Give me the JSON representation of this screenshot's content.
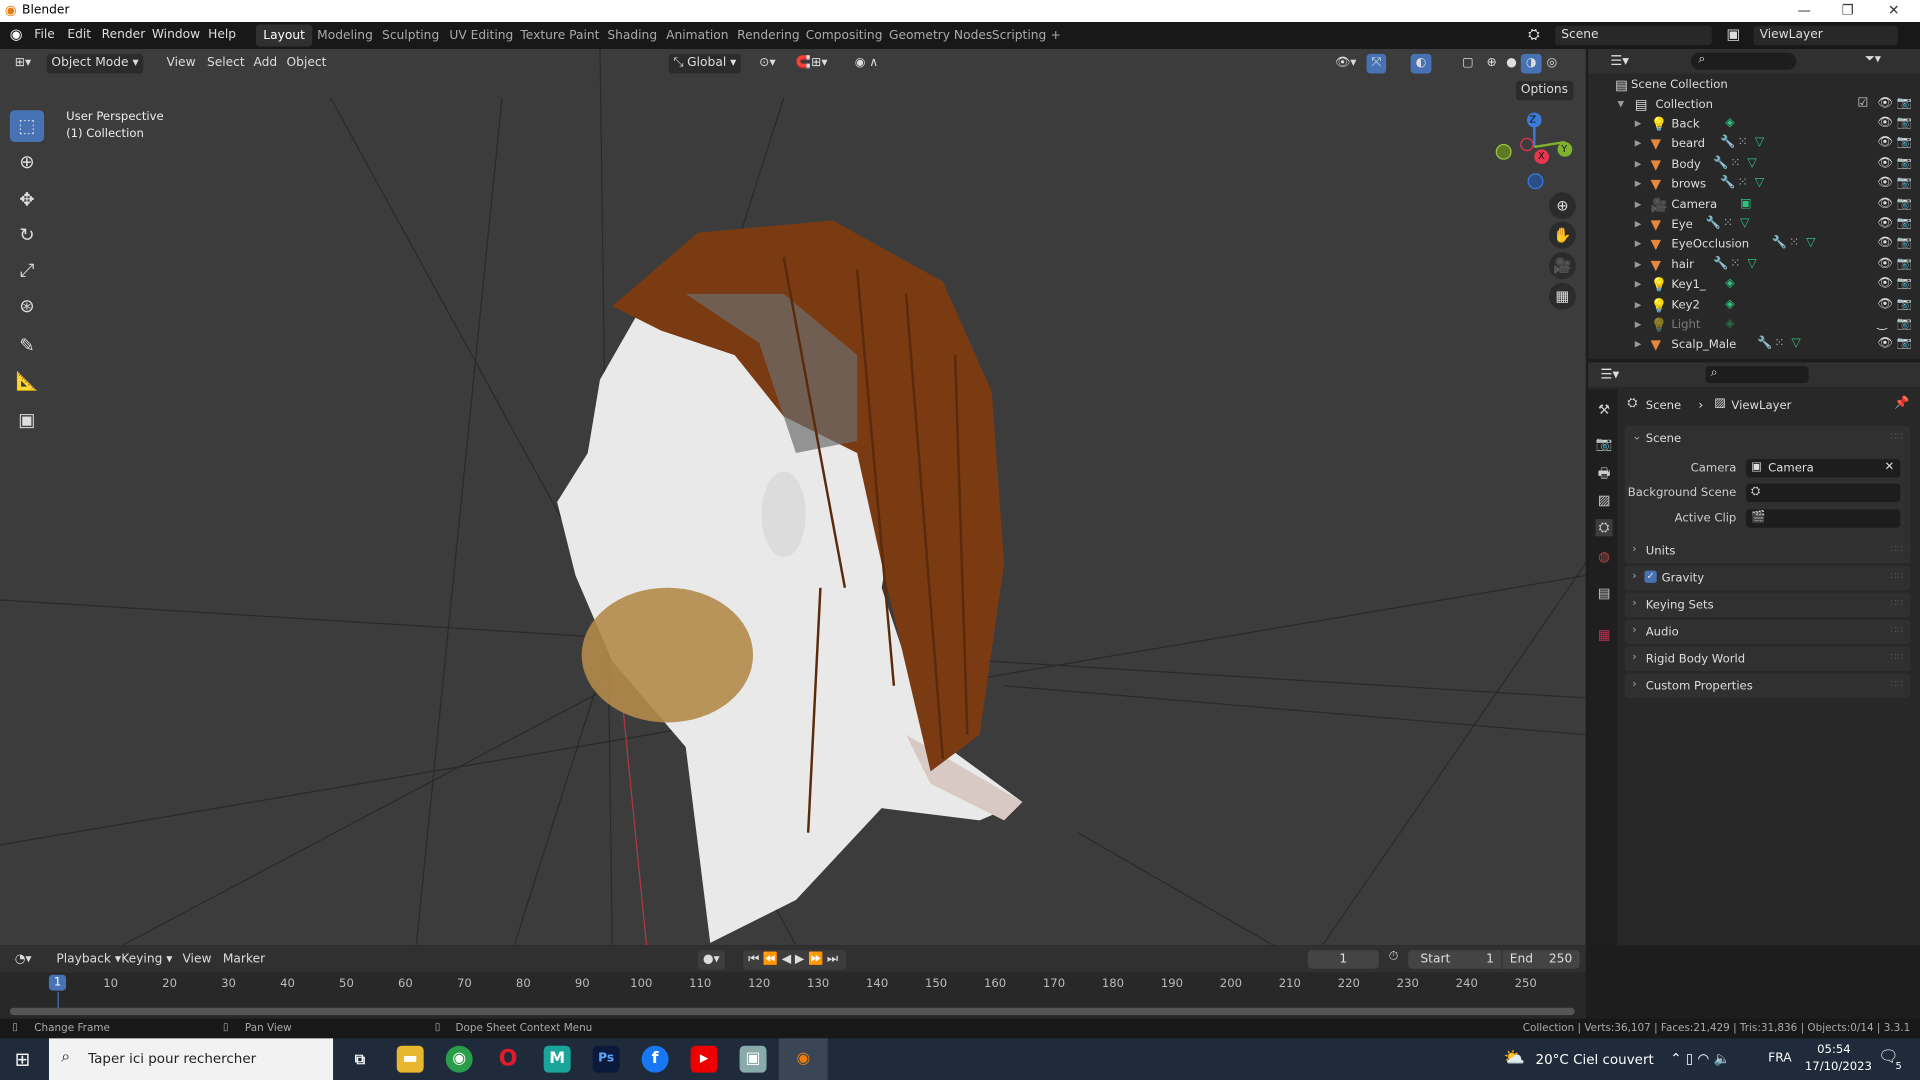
{
  "window": {
    "title": "Blender",
    "min": "—",
    "max": "❐",
    "close": "✕"
  },
  "menu": [
    "File",
    "Edit",
    "Render",
    "Window",
    "Help"
  ],
  "workspaces": [
    "Layout",
    "Modeling",
    "Sculpting",
    "UV Editing",
    "Texture Paint",
    "Shading",
    "Animation",
    "Rendering",
    "Compositing",
    "Geometry Nodes",
    "Scripting",
    "+"
  ],
  "scene": {
    "name": "Scene",
    "view_layer": "ViewLayer"
  },
  "viewport": {
    "mode": "Object Mode",
    "menus": [
      "View",
      "Select",
      "Add",
      "Object"
    ],
    "orientation": "Global",
    "options": "Options",
    "view_name": "User Perspective",
    "collection": "(1) Collection",
    "gizmo": {
      "x": "X",
      "y": "Y",
      "z": "Z"
    }
  },
  "outliner": {
    "root": "Scene Collection",
    "collection": "Collection",
    "items": [
      {
        "name": "Back",
        "type": "light"
      },
      {
        "name": "beard",
        "type": "mesh"
      },
      {
        "name": "Body",
        "type": "mesh"
      },
      {
        "name": "brows",
        "type": "mesh"
      },
      {
        "name": "Camera",
        "type": "camera"
      },
      {
        "name": "Eye",
        "type": "mesh"
      },
      {
        "name": "EyeOcclusion",
        "type": "mesh"
      },
      {
        "name": "hair",
        "type": "mesh"
      },
      {
        "name": "Key1_",
        "type": "light"
      },
      {
        "name": "Key2",
        "type": "light"
      },
      {
        "name": "Light",
        "type": "light",
        "hidden": true
      },
      {
        "name": "Scalp_Male",
        "type": "mesh"
      }
    ]
  },
  "properties": {
    "breadcrumb": [
      "Scene",
      "ViewLayer"
    ],
    "scene_panel": "Scene",
    "camera_label": "Camera",
    "camera_value": "Camera",
    "bg_scene_label": "Background Scene",
    "active_clip_label": "Active Clip",
    "panels": [
      "Units",
      "Gravity",
      "Keying Sets",
      "Audio",
      "Rigid Body World",
      "Custom Properties"
    ],
    "gravity_checked": true
  },
  "timeline": {
    "menus": [
      "Playback",
      "Keying",
      "View",
      "Marker"
    ],
    "current_frame": "1",
    "start_label": "Start",
    "start": "1",
    "end_label": "End",
    "end": "250",
    "ticks": [
      "1",
      "10",
      "20",
      "30",
      "40",
      "50",
      "60",
      "70",
      "80",
      "90",
      "100",
      "110",
      "120",
      "130",
      "140",
      "150",
      "160",
      "170",
      "180",
      "190",
      "200",
      "210",
      "220",
      "230",
      "240",
      "250"
    ]
  },
  "status": {
    "left": [
      "Change Frame",
      "Pan View",
      "Dope Sheet Context Menu"
    ],
    "right": "Collection | Verts:36,107 | Faces:21,429 | Tris:31,836 | Objects:0/14 | 3.3.1"
  },
  "taskbar": {
    "search_placeholder": "Taper ici pour rechercher",
    "weather": "20°C  Ciel couvert",
    "lang": "FRA",
    "time": "05:54",
    "date": "17/10/2023",
    "notif": "5"
  }
}
